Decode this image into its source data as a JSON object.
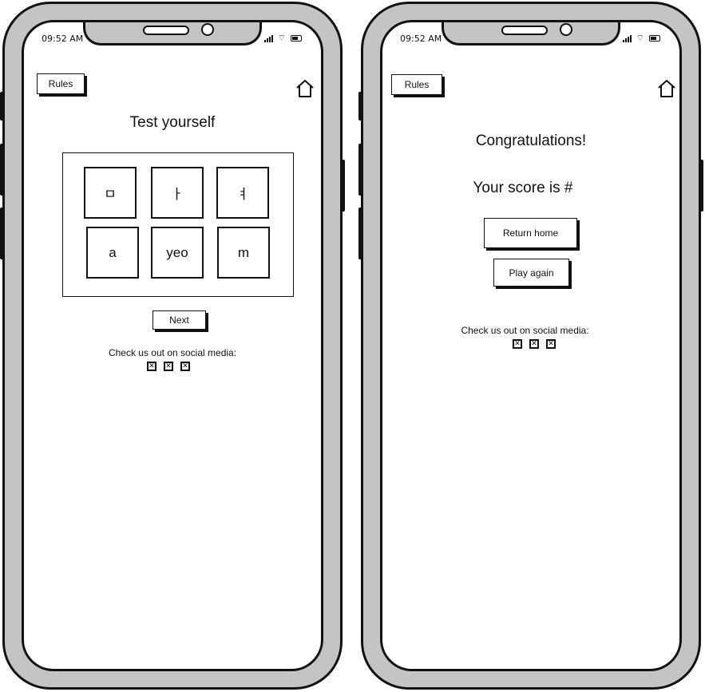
{
  "status_bar": {
    "time": "09:52 AM"
  },
  "quiz_screen": {
    "rules_label": "Rules",
    "title": "Test yourself",
    "tiles": [
      "ㅁ",
      "ㅏ",
      "ㅕ",
      "a",
      "yeo",
      "m"
    ],
    "next_label": "Next",
    "social_label": "Check us out on social media:"
  },
  "result_screen": {
    "rules_label": "Rules",
    "congrats": "Congratulations!",
    "score_text": "Your score is #",
    "return_home_label": "Return home",
    "play_again_label": "Play again",
    "social_label": "Check us out on social media:"
  },
  "icons": {
    "home": "home-icon",
    "social": "broken-image-icon",
    "signal": "signal-icon",
    "wifi": "wifi-icon",
    "battery": "battery-icon"
  }
}
